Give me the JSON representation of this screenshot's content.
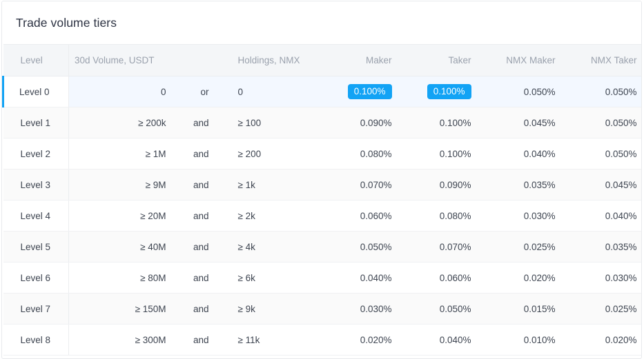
{
  "card": {
    "title": "Trade volume tiers"
  },
  "table": {
    "columns": [
      {
        "key": "level",
        "label": "Level"
      },
      {
        "key": "volume",
        "label": "30d Volume, USDT"
      },
      {
        "key": "conjunction",
        "label": ""
      },
      {
        "key": "holdings",
        "label": "Holdings, NMX"
      },
      {
        "key": "maker",
        "label": "Maker"
      },
      {
        "key": "taker",
        "label": "Taker"
      },
      {
        "key": "nmx_maker",
        "label": "NMX Maker"
      },
      {
        "key": "nmx_taker",
        "label": "NMX Taker"
      }
    ],
    "rows": [
      {
        "level": "Level 0",
        "volume": "0",
        "conjunction": "or",
        "holdings": "0",
        "maker": "0.100%",
        "taker": "0.100%",
        "nmx_maker": "0.050%",
        "nmx_taker": "0.050%",
        "active": true,
        "maker_highlighted": true,
        "taker_highlighted": true
      },
      {
        "level": "Level 1",
        "volume": "≥ 200k",
        "conjunction": "and",
        "holdings": "≥ 100",
        "maker": "0.090%",
        "taker": "0.100%",
        "nmx_maker": "0.045%",
        "nmx_taker": "0.050%",
        "active": false,
        "maker_highlighted": false,
        "taker_highlighted": false
      },
      {
        "level": "Level 2",
        "volume": "≥ 1M",
        "conjunction": "and",
        "holdings": "≥ 200",
        "maker": "0.080%",
        "taker": "0.100%",
        "nmx_maker": "0.040%",
        "nmx_taker": "0.050%",
        "active": false,
        "maker_highlighted": false,
        "taker_highlighted": false
      },
      {
        "level": "Level 3",
        "volume": "≥ 9M",
        "conjunction": "and",
        "holdings": "≥ 1k",
        "maker": "0.070%",
        "taker": "0.090%",
        "nmx_maker": "0.035%",
        "nmx_taker": "0.045%",
        "active": false,
        "maker_highlighted": false,
        "taker_highlighted": false
      },
      {
        "level": "Level 4",
        "volume": "≥ 20M",
        "conjunction": "and",
        "holdings": "≥ 2k",
        "maker": "0.060%",
        "taker": "0.080%",
        "nmx_maker": "0.030%",
        "nmx_taker": "0.040%",
        "active": false,
        "maker_highlighted": false,
        "taker_highlighted": false
      },
      {
        "level": "Level 5",
        "volume": "≥ 40M",
        "conjunction": "and",
        "holdings": "≥ 4k",
        "maker": "0.050%",
        "taker": "0.070%",
        "nmx_maker": "0.025%",
        "nmx_taker": "0.035%",
        "active": false,
        "maker_highlighted": false,
        "taker_highlighted": false
      },
      {
        "level": "Level 6",
        "volume": "≥ 80M",
        "conjunction": "and",
        "holdings": "≥ 6k",
        "maker": "0.040%",
        "taker": "0.060%",
        "nmx_maker": "0.020%",
        "nmx_taker": "0.030%",
        "active": false,
        "maker_highlighted": false,
        "taker_highlighted": false
      },
      {
        "level": "Level 7",
        "volume": "≥ 150M",
        "conjunction": "and",
        "holdings": "≥ 9k",
        "maker": "0.030%",
        "taker": "0.050%",
        "nmx_maker": "0.015%",
        "nmx_taker": "0.025%",
        "active": false,
        "maker_highlighted": false,
        "taker_highlighted": false
      },
      {
        "level": "Level 8",
        "volume": "≥ 300M",
        "conjunction": "and",
        "holdings": "≥ 11k",
        "maker": "0.020%",
        "taker": "0.040%",
        "nmx_maker": "0.010%",
        "nmx_taker": "0.020%",
        "active": false,
        "maker_highlighted": false,
        "taker_highlighted": false
      }
    ]
  },
  "colors": {
    "accent": "#12a3f5",
    "active_row_bg": "#f3f8ff",
    "stripe_bg": "#fafafa",
    "header_bg": "#f4f6f8",
    "title_text": "#2c3242",
    "muted_text": "#9aa1ad"
  }
}
